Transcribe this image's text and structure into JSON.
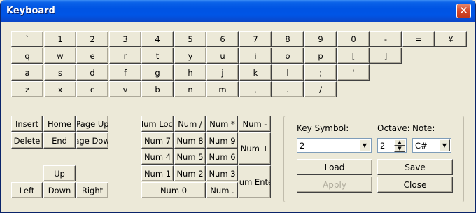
{
  "window": {
    "title": "Keyboard",
    "close_glyph": "✕"
  },
  "keyboard": {
    "row1": [
      "`",
      "1",
      "2",
      "3",
      "4",
      "5",
      "6",
      "7",
      "8",
      "9",
      "0",
      "-",
      "=",
      "¥"
    ],
    "row2": [
      "q",
      "w",
      "e",
      "r",
      "t",
      "y",
      "u",
      "i",
      "o",
      "p",
      "[",
      "]"
    ],
    "row3": [
      "a",
      "s",
      "d",
      "f",
      "g",
      "h",
      "j",
      "k",
      "l",
      ";",
      "'"
    ],
    "row4": [
      "z",
      "x",
      "c",
      "v",
      "b",
      "n",
      "m",
      ",",
      ".",
      "/"
    ]
  },
  "nav": {
    "insert": "Insert",
    "home": "Home",
    "page_up": "Page Up",
    "delete": "Delete",
    "end": "End",
    "page_down": "Page Down",
    "up": "Up",
    "left": "Left",
    "down": "Down",
    "right": "Right"
  },
  "numpad": {
    "num_lock": "Num Lock",
    "num_div": "Num /",
    "num_mul": "Num *",
    "num_minus": "Num -",
    "num7": "Num 7",
    "num8": "Num 8",
    "num9": "Num 9",
    "num_plus": "Num +",
    "num4": "Num 4",
    "num5": "Num 5",
    "num6": "Num 6",
    "num1": "Num 1",
    "num2": "Num 2",
    "num3": "Num 3",
    "num_enter": "Num Enter",
    "num0": "Num 0",
    "num_dot": "Num ."
  },
  "panel": {
    "key_symbol_label": "Key Symbol:",
    "key_symbol_value": "2",
    "octave_label": "Octave:",
    "octave_value": "2",
    "note_label": "Note:",
    "note_value": "C#",
    "load": "Load",
    "save": "Save",
    "apply": "Apply",
    "close": "Close"
  }
}
